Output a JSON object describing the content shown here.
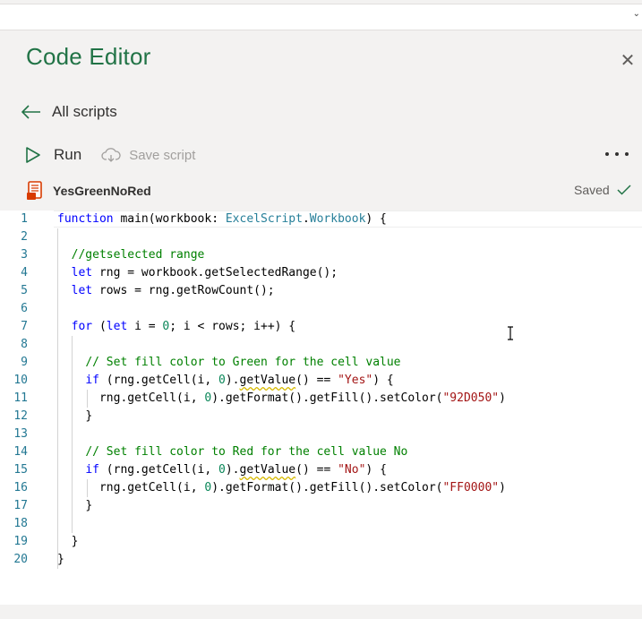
{
  "pane": {
    "title": "Code Editor",
    "back_label": "All scripts",
    "run_label": "Run",
    "save_label": "Save script",
    "script_name": "YesGreenNoRed",
    "saved_label": "Saved"
  },
  "icons": {
    "close": "close-icon",
    "back": "arrow-left-icon",
    "run": "play-icon",
    "save": "cloud-save-icon",
    "more": "more-icon",
    "file": "script-file-icon",
    "saved": "checkmark-icon",
    "cursor": "text-cursor-icon"
  },
  "colors": {
    "accent": "#217346",
    "pane_background": "#f3f2f1",
    "file_icon": "#d83b01",
    "line_number": "#237893",
    "keyword": "#0000ff",
    "type": "#267f99",
    "comment": "#008000",
    "string": "#a31515"
  },
  "code": {
    "line_numbers": [
      "1",
      "2",
      "3",
      "4",
      "5",
      "6",
      "7",
      "8",
      "9",
      "10",
      "11",
      "12",
      "13",
      "14",
      "15",
      "16",
      "17",
      "18",
      "19",
      "20"
    ],
    "l1": {
      "kw": "function",
      "t1": " main(workbook: ",
      "type": "ExcelScript",
      "t2": ".",
      "type2": "Workbook",
      "t3": ") {"
    },
    "l3": "//getselected range",
    "l4": {
      "kw": "let",
      "t": " rng = workbook.getSelectedRange();"
    },
    "l5": {
      "kw": "let",
      "t": " rows = rng.getRowCount();"
    },
    "l7": {
      "kw": "for",
      "t1": " (",
      "kw2": "let",
      "t2": " i = ",
      "n": "0",
      "t3": "; i < rows; i++) {"
    },
    "l9": "// Set fill color to Green for the cell value",
    "l10": {
      "kw": "if",
      "t1": " (rng.getCell(i, ",
      "n": "0",
      "t2": ").",
      "sq": "getValue",
      "t3": "() == ",
      "s": "\"Yes\"",
      "t4": ") {"
    },
    "l11": {
      "t1": "rng.getCell(i, ",
      "n": "0",
      "t2": ").getFormat().getFill().setColor(",
      "s": "\"92D050\"",
      "t3": ")"
    },
    "l12": "}",
    "l14": "// Set fill color to Red for the cell value No",
    "l15": {
      "kw": "if",
      "t1": " (rng.getCell(i, ",
      "n": "0",
      "t2": ").",
      "sq": "getValue",
      "t3": "() == ",
      "s": "\"No\"",
      "t4": ") {"
    },
    "l16": {
      "t1": "rng.getCell(i, ",
      "n": "0",
      "t2": ").getFormat().getFill().setColor(",
      "s": "\"FF0000\"",
      "t3": ")"
    },
    "l17": "}",
    "l19": "}",
    "l20": "}"
  }
}
